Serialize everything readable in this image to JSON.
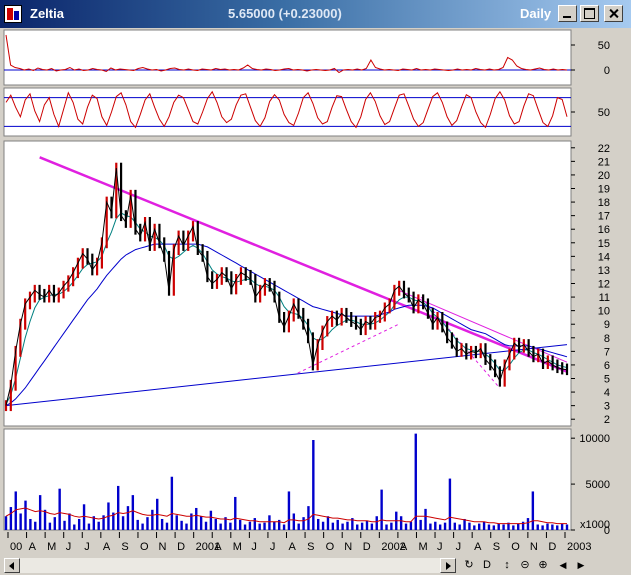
{
  "window": {
    "title": "Zeltia",
    "price_line": "5.65000 (+0.23000)",
    "period": "Daily"
  },
  "toolbar": {
    "icons": [
      "refresh-icon",
      "d-icon",
      "updown-icon",
      "zoom-out-icon",
      "zoom-in-icon",
      "left-icon",
      "right-icon"
    ],
    "d_label": "D",
    "glyphs": [
      "↻",
      "D",
      "↕",
      "⊝",
      "⊕",
      "◀",
      "▶"
    ]
  },
  "colors": {
    "price": "#000000",
    "up_bar": "#cc0000",
    "trendline": "#e020e0",
    "ma_short": "#008080",
    "ma_long": "#0000cc",
    "volume": "#0000cc",
    "indicator": "#cc0000"
  },
  "chart_data": [
    {
      "type": "line",
      "panel": "indicator-1",
      "yticks": [
        50,
        0
      ],
      "ylim": [
        -30,
        80
      ],
      "reference_line": 0,
      "series": [
        {
          "values": [
            70,
            10,
            5,
            3,
            0,
            2,
            -1,
            4,
            1,
            0,
            3,
            -2,
            0,
            1,
            5,
            0,
            2,
            -1,
            0,
            3,
            1,
            0,
            -3,
            4,
            0,
            2,
            1,
            0,
            -1,
            3,
            5,
            2,
            0,
            1,
            -2,
            0,
            3,
            4,
            1,
            0,
            2,
            0,
            -1,
            2,
            1,
            0,
            3,
            1,
            2,
            0,
            1,
            0,
            4,
            10,
            3,
            1,
            0,
            2,
            1,
            -1,
            0,
            2,
            3,
            0,
            1,
            0,
            -2,
            0,
            1,
            0,
            -1,
            0,
            3,
            -5,
            0,
            1,
            0,
            2,
            0,
            3,
            20,
            5,
            2,
            0,
            1,
            0,
            -1,
            2,
            1,
            0,
            3,
            0,
            1,
            0,
            2,
            1,
            0,
            -1,
            0,
            2,
            0,
            1,
            0,
            3,
            1,
            0,
            2,
            0,
            1,
            5,
            25,
            20,
            8,
            3,
            1,
            0,
            2,
            4,
            1,
            0,
            2,
            0,
            1,
            0
          ]
        }
      ]
    },
    {
      "type": "line",
      "panel": "indicator-2",
      "yticks": [
        50
      ],
      "ylim": [
        0,
        100
      ],
      "reference_lines": [
        80,
        20
      ],
      "series": [
        {
          "values": [
            70,
            85,
            60,
            40,
            75,
            88,
            52,
            30,
            65,
            80,
            45,
            20,
            55,
            90,
            70,
            35,
            25,
            60,
            85,
            78,
            40,
            22,
            50,
            82,
            90,
            65,
            30,
            18,
            45,
            75,
            88,
            60,
            35,
            20,
            40,
            70,
            85,
            80,
            55,
            30,
            25,
            50,
            78,
            92,
            70,
            40,
            28,
            35,
            65,
            85,
            88,
            60,
            32,
            20,
            38,
            72,
            86,
            75,
            45,
            28,
            22,
            48,
            80,
            90,
            68,
            38,
            25,
            30,
            60,
            84,
            82,
            55,
            30,
            18,
            40,
            76,
            90,
            72,
            42,
            24,
            30,
            58,
            85,
            88,
            62,
            35,
            20,
            28,
            55,
            82,
            90,
            70,
            40,
            22,
            32,
            60,
            86,
            80,
            50,
            28,
            18,
            45,
            78,
            92,
            75,
            42,
            25,
            30,
            62,
            88,
            84,
            55,
            28,
            20,
            42,
            80,
            76,
            40
          ]
        }
      ]
    },
    {
      "type": "line",
      "panel": "price",
      "x_start": "2000",
      "x_end": "2003",
      "yticks": [
        2,
        3,
        4,
        5,
        6,
        7,
        8,
        9,
        10,
        11,
        12,
        13,
        14,
        15,
        16,
        17,
        18,
        19,
        20,
        21,
        22
      ],
      "ylim": [
        1.5,
        22.5
      ],
      "xticks": [
        "00",
        "A",
        "M",
        "J",
        "J",
        "A",
        "S",
        "O",
        "N",
        "D",
        "2001",
        "A",
        "M",
        "J",
        "J",
        "A",
        "S",
        "O",
        "N",
        "D",
        "2002",
        "A",
        "M",
        "J",
        "J",
        "A",
        "S",
        "O",
        "N",
        "D",
        "2003"
      ],
      "series": [
        {
          "values": [
            3.0,
            4.5,
            7.0,
            9.0,
            10.5,
            11.0,
            11.5,
            11.2,
            11.0,
            11.5,
            11.0,
            11.3,
            11.8,
            12.2,
            12.8,
            13.5,
            14.2,
            13.8,
            13.0,
            13.5,
            15.0,
            18.0,
            17.2,
            20.5,
            17.0,
            16.5,
            18.5,
            16.0,
            15.5,
            16.5,
            14.8,
            16.0,
            15.0,
            14.0,
            11.5,
            14.5,
            15.5,
            14.8,
            15.5,
            16.2,
            14.5,
            14.0,
            12.5,
            12.0,
            12.3,
            12.8,
            12.5,
            11.6,
            12.3,
            12.8,
            12.6,
            12.3,
            11.0,
            11.5,
            12.0,
            11.8,
            11.0,
            9.5,
            8.8,
            9.6,
            10.5,
            9.8,
            9.0,
            8.0,
            6.0,
            7.5,
            8.5,
            9.2,
            9.6,
            9.3,
            9.8,
            9.5,
            9.2,
            9.0,
            8.6,
            9.2,
            9.0,
            9.5,
            9.6,
            10.2,
            10.5,
            11.5,
            11.8,
            11.3,
            11.0,
            10.2,
            10.8,
            10.5,
            9.8,
            9.0,
            9.5,
            8.8,
            8.0,
            7.6,
            7.0,
            7.2,
            6.8,
            7.0,
            6.9,
            7.2,
            6.4,
            6.0,
            5.5,
            4.8,
            6.0,
            6.8,
            7.6,
            7.3,
            7.5,
            7.0,
            6.6,
            6.8,
            6.1,
            6.3,
            6.0,
            5.8,
            5.7,
            5.65
          ]
        },
        {
          "values": [
            3.1,
            3.8,
            5.0,
            6.5,
            8.0,
            9.2,
            10.2,
            10.8,
            11.0,
            11.1,
            11.2,
            11.2,
            11.4,
            11.7,
            12.1,
            12.6,
            13.1,
            13.4,
            13.5,
            13.6,
            14.0,
            15.0,
            15.8,
            16.8,
            17.2,
            17.0,
            16.9,
            16.5,
            16.0,
            15.8,
            15.5,
            15.4,
            15.2,
            14.8,
            14.0,
            13.8,
            14.0,
            14.3,
            14.6,
            14.8,
            14.6,
            14.2,
            13.6,
            13.0,
            12.7,
            12.5,
            12.4,
            12.2,
            12.1,
            12.2,
            12.3,
            12.3,
            12.0,
            11.8,
            11.8,
            11.7,
            11.5,
            11.0,
            10.3,
            9.9,
            9.8,
            9.7,
            9.4,
            8.9,
            8.0,
            7.8,
            7.9,
            8.2,
            8.6,
            8.9,
            9.1,
            9.3,
            9.3,
            9.2,
            9.0,
            9.0,
            9.0,
            9.1,
            9.3,
            9.6,
            9.9,
            10.4,
            10.8,
            11.0,
            11.0,
            10.8,
            10.7,
            10.6,
            10.3,
            9.8,
            9.5,
            9.2,
            8.7,
            8.3,
            7.8,
            7.5,
            7.2,
            7.1,
            7.0,
            7.0,
            6.8,
            6.5,
            6.1,
            5.6,
            5.6,
            6.0,
            6.5,
            6.9,
            7.1,
            7.1,
            6.9,
            6.8,
            6.6,
            6.4,
            6.2,
            6.0,
            5.9,
            5.8
          ]
        },
        {
          "values": [
            3.0,
            3.2,
            3.5,
            3.9,
            4.3,
            4.8,
            5.3,
            5.8,
            6.3,
            6.8,
            7.3,
            7.8,
            8.3,
            8.8,
            9.3,
            9.8,
            10.3,
            10.8,
            11.2,
            11.6,
            12.1,
            12.6,
            13.0,
            13.4,
            13.8,
            14.1,
            14.3,
            14.5,
            14.6,
            14.7,
            14.8,
            14.9,
            14.9,
            14.9,
            14.9,
            14.9,
            14.9,
            14.9,
            14.9,
            14.9,
            14.9,
            14.8,
            14.7,
            14.5,
            14.3,
            14.1,
            13.9,
            13.7,
            13.5,
            13.3,
            13.1,
            12.9,
            12.7,
            12.5,
            12.3,
            12.1,
            11.9,
            11.7,
            11.5,
            11.3,
            11.1,
            10.9,
            10.7,
            10.5,
            10.3,
            10.2,
            10.1,
            10.0,
            9.9,
            9.8,
            9.7,
            9.6,
            9.6,
            9.6,
            9.6,
            9.6,
            9.6,
            9.6,
            9.7,
            9.8,
            9.9,
            10.1,
            10.2,
            10.3,
            10.4,
            10.4,
            10.4,
            10.4,
            10.3,
            10.2,
            10.0,
            9.8,
            9.6,
            9.4,
            9.2,
            9.0,
            8.8,
            8.6,
            8.5,
            8.4,
            8.3,
            8.1,
            7.9,
            7.7,
            7.5,
            7.4,
            7.4,
            7.4,
            7.4,
            7.4,
            7.3,
            7.2,
            7.1,
            7.0,
            6.9,
            6.8,
            6.7,
            6.6
          ]
        }
      ],
      "trendlines": [
        {
          "from": [
            0.06,
            21.3
          ],
          "to": [
            1.0,
            5.5
          ],
          "style": "solid-thick"
        },
        {
          "from": [
            0.0,
            3.0
          ],
          "to": [
            1.0,
            7.5
          ],
          "style": "solid-thin"
        },
        {
          "from": [
            0.52,
            5.4
          ],
          "to": [
            0.7,
            9.0
          ],
          "style": "dashed"
        },
        {
          "from": [
            0.74,
            11.0
          ],
          "to": [
            0.88,
            4.3
          ],
          "style": "dashed"
        },
        {
          "from": [
            0.7,
            11.5
          ],
          "to": [
            1.0,
            6.2
          ],
          "style": "solid-thin"
        }
      ]
    },
    {
      "type": "bar",
      "panel": "volume",
      "yticks": [
        10000,
        5000,
        0
      ],
      "ylim": [
        0,
        11000
      ],
      "unit_label": "x1000",
      "series": [
        {
          "values": [
            1500,
            2500,
            4200,
            1800,
            3200,
            1200,
            900,
            3800,
            2200,
            800,
            1400,
            4500,
            1000,
            1800,
            600,
            1200,
            2800,
            700,
            1500,
            900,
            1600,
            3000,
            1900,
            4800,
            1500,
            2600,
            3800,
            1100,
            700,
            1400,
            2200,
            3400,
            1200,
            800,
            5800,
            1600,
            1000,
            700,
            1800,
            2400,
            1500,
            900,
            2100,
            1200,
            700,
            1400,
            800,
            3600,
            1100,
            600,
            900,
            1300,
            700,
            800,
            1600,
            900,
            1100,
            600,
            4200,
            1800,
            700,
            1400,
            2600,
            9800,
            1200,
            900,
            1500,
            800,
            1100,
            700,
            900,
            1300,
            600,
            800,
            1000,
            700,
            1500,
            4400,
            600,
            800,
            2000,
            1500,
            700,
            900,
            10500,
            1100,
            2300,
            700,
            900,
            600,
            800,
            5600,
            800,
            600,
            1200,
            800,
            500,
            700,
            900,
            600,
            500,
            700,
            600,
            800,
            500,
            700,
            900,
            1300,
            4200,
            600,
            500,
            700,
            600,
            500,
            700,
            600
          ]
        },
        {
          "values": [
            1500,
            1800,
            2200,
            2300,
            2400,
            2200,
            2000,
            2100,
            2000,
            1800,
            1700,
            1900,
            1800,
            1700,
            1500,
            1400,
            1500,
            1400,
            1300,
            1200,
            1300,
            1500,
            1600,
            1900,
            1800,
            1900,
            2100,
            1900,
            1700,
            1600,
            1600,
            1700,
            1600,
            1500,
            1800,
            1700,
            1600,
            1500,
            1500,
            1600,
            1500,
            1400,
            1400,
            1300,
            1200,
            1200,
            1100,
            1300,
            1200,
            1100,
            1000,
            1000,
            900,
            900,
            900,
            900,
            900,
            800,
            1100,
            1100,
            1000,
            1000,
            1200,
            1700,
            1600,
            1500,
            1400,
            1300,
            1300,
            1200,
            1100,
            1100,
            1000,
            1000,
            1000,
            900,
            900,
            1100,
            1000,
            1000,
            1000,
            1000,
            900,
            900,
            1500,
            1500,
            1500,
            1400,
            1300,
            1200,
            1100,
            1400,
            1300,
            1200,
            1100,
            1000,
            900,
            900,
            900,
            800,
            800,
            700,
            700,
            700,
            700,
            700,
            700,
            800,
            1000,
            1000,
            900,
            800,
            800,
            700,
            700,
            700
          ]
        }
      ]
    }
  ]
}
